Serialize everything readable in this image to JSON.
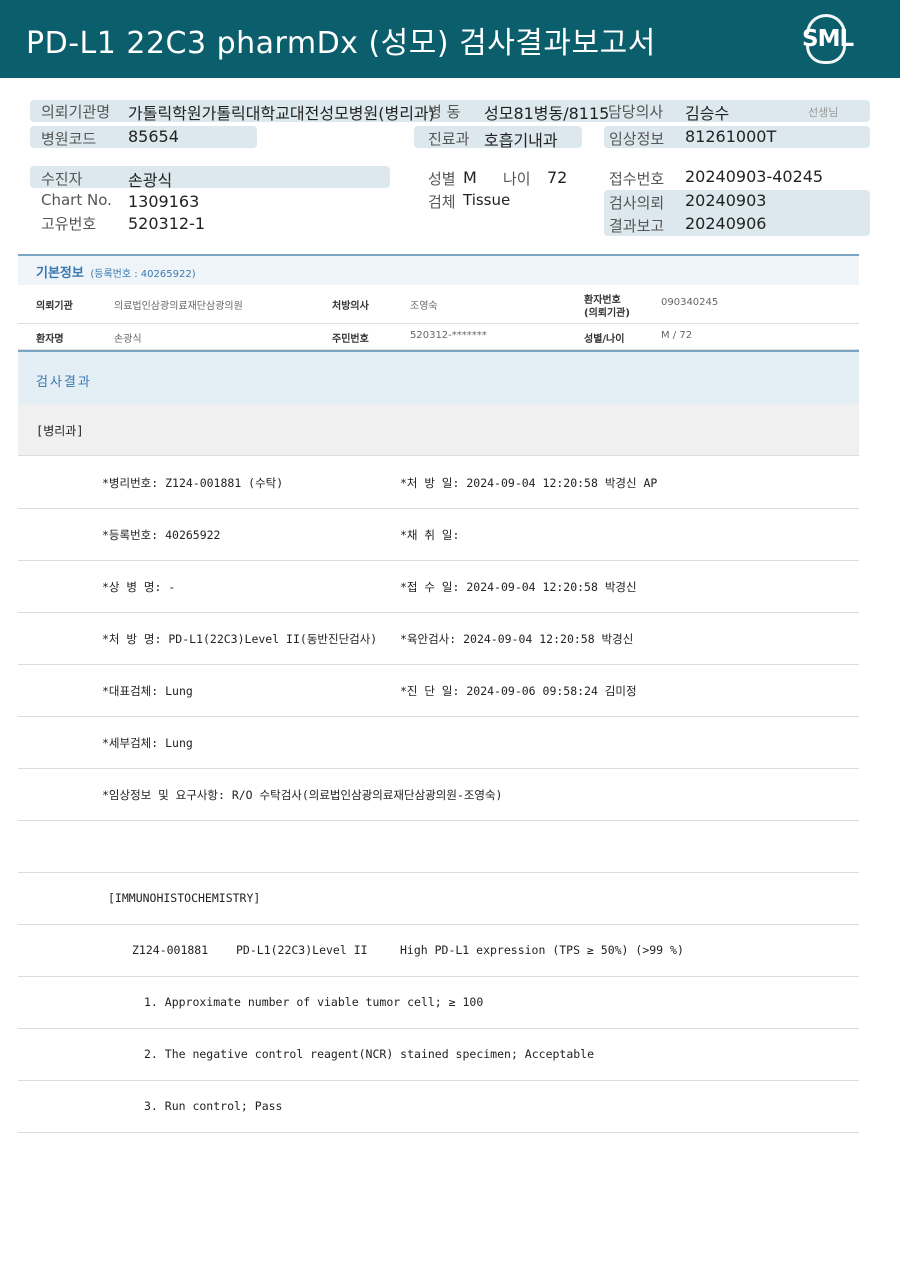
{
  "header": {
    "title": "PD-L1 22C3 pharmDx (성모) 검사결과보고서",
    "logo_text": "SML"
  },
  "summary": {
    "requester_label": "의뢰기관명",
    "requester_value": "가톨릭학원가톨릭대학교대전성모병원(병리과)",
    "ward_label": "병 동",
    "ward_value": "성모81병동/8115",
    "doctor_label": "담당의사",
    "doctor_value": "김승수",
    "doctor_suffix": "선생님",
    "hospital_code_label": "병원코드",
    "hospital_code_value": "85654",
    "dept_label": "진료과",
    "dept_value": "호흡기내과",
    "clinical_label": "임상정보",
    "clinical_value": "81261000T",
    "patient_label": "수진자",
    "patient_value": "손광식",
    "sex_label": "성별",
    "sex_value": "M",
    "age_label": "나이",
    "age_value": "72",
    "receipt_no_label": "접수번호",
    "receipt_no_value": "20240903-40245",
    "chart_label": "Chart No.",
    "chart_value": "1309163",
    "specimen_label": "검체",
    "specimen_value": "Tissue",
    "request_date_label": "검사의뢰",
    "request_date_value": "20240903",
    "id_label": "고유번호",
    "id_value": "520312-1",
    "report_date_label": "결과보고",
    "report_date_value": "20240906"
  },
  "basic_info": {
    "title": "기본정보",
    "reg_no": "(등록번호 : 40265922)",
    "rows": [
      {
        "l1": "의뢰기관",
        "v1": "의료법인삼광의료재단삼광의원",
        "l2": "처방의사",
        "v2": "조영숙",
        "l3a": "환자번호",
        "l3b": "(의뢰기관)",
        "v3": "090340245"
      },
      {
        "l1": "환자명",
        "v1": "손광식",
        "l2": "주민번호",
        "v2": "520312-*******",
        "l3": "성별/나이",
        "v3": "M / 72"
      }
    ]
  },
  "results": {
    "title": "검사결과",
    "pathology_header": "[병리과]",
    "rows": [
      {
        "left": "*병리번호: Z124-001881 (수탁)",
        "right": "*처 방 일: 2024-09-04 12:20:58  박경신 AP"
      },
      {
        "left": "*등록번호: 40265922",
        "right": "*채 취 일:"
      },
      {
        "left": "*상 병 명: -",
        "right": "*접 수 일: 2024-09-04 12:20:58  박경신"
      },
      {
        "left": "*처 방 명: PD-L1(22C3)Level II(동반진단검사)",
        "right": "*육안검사: 2024-09-04 12:20:58  박경신"
      },
      {
        "left": "*대표검체: Lung",
        "right": "*진 단 일: 2024-09-06 09:58:24  김미정"
      },
      {
        "left": "*세부검체: Lung",
        "right": ""
      },
      {
        "left": "*임상정보 및 요구사항: R/O 수탁검사(의료법인삼광의료재단삼광의원-조영숙)",
        "right": ""
      },
      {
        "left": "",
        "right": ""
      }
    ],
    "ihc_header": "[IMMUNOHISTOCHEMISTRY]",
    "ihc_line": {
      "a": "Z124-001881",
      "b": "PD-L1(22C3)Level II",
      "c": "High PD-L1 expression (TPS ≥ 50%) (>99 %)"
    },
    "notes": [
      "1. Approximate number of viable tumor cell; ≥ 100",
      "2. The negative control reagent(NCR) stained specimen; Acceptable",
      "3. Run control; Pass"
    ]
  }
}
